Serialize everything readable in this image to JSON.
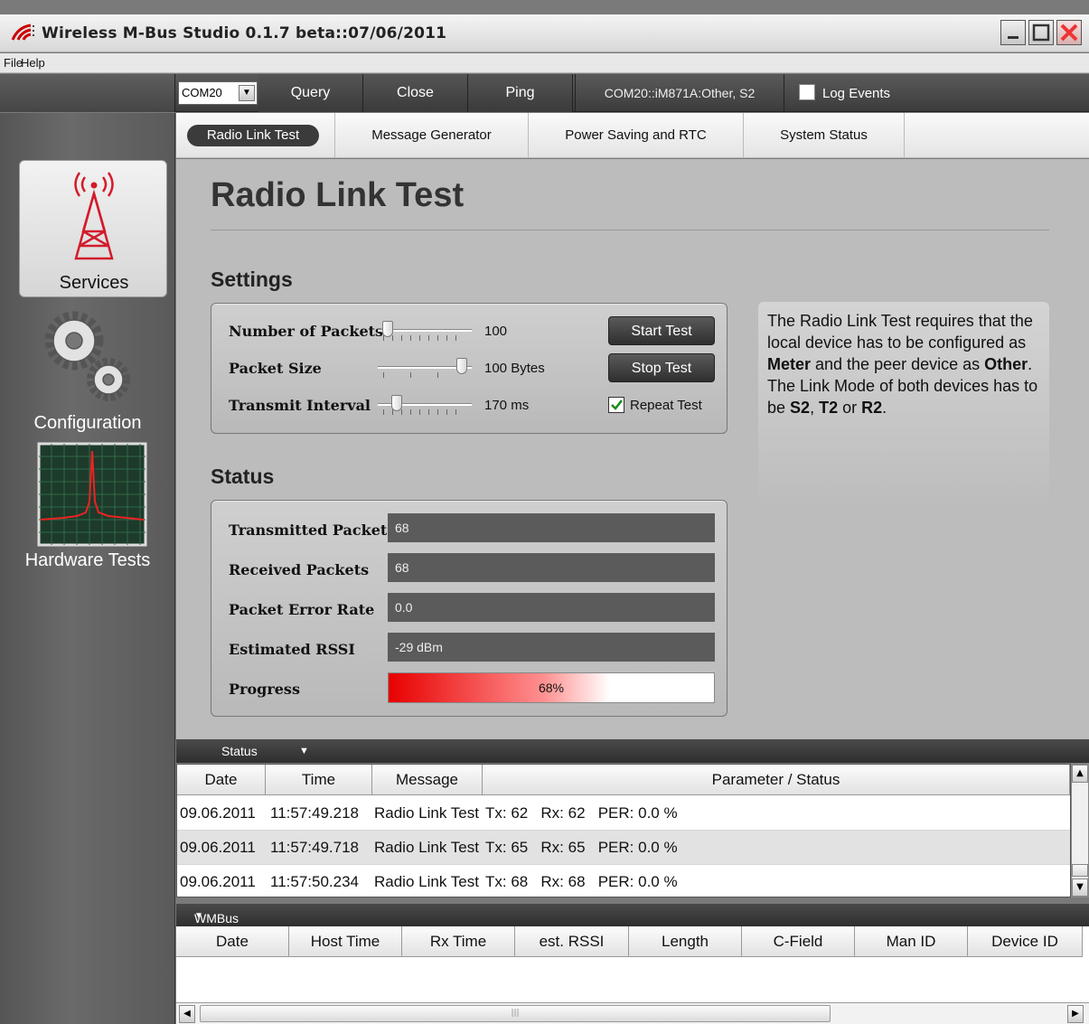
{
  "window": {
    "title": "Wireless M-Bus Studio  0.1.7 beta::07/06/2011"
  },
  "menu": {
    "file": "File",
    "help": "Help"
  },
  "toolbar": {
    "port_value": "COM20",
    "query_label": "Query",
    "close_label": "Close",
    "ping_label": "Ping",
    "connection_info": "COM20::iM871A:Other, S2",
    "log_events_label": "Log Events",
    "log_events_checked": false
  },
  "sidebar": {
    "items": [
      {
        "label": "Services",
        "icon": "radio-tower-icon",
        "active": true
      },
      {
        "label": "Configuration",
        "icon": "gears-icon",
        "active": false
      },
      {
        "label": "Hardware Tests",
        "icon": "spectrum-analyzer-icon",
        "active": false
      }
    ]
  },
  "tabs": [
    {
      "label": "Radio Link Test",
      "active": true
    },
    {
      "label": "Message Generator",
      "active": false
    },
    {
      "label": "Power Saving and RTC",
      "active": false
    },
    {
      "label": "System Status",
      "active": false
    }
  ],
  "page": {
    "title": "Radio Link Test",
    "settings_heading": "Settings",
    "status_heading": "Status"
  },
  "settings": {
    "num_packets": {
      "label": "Number of Packets",
      "value": "100",
      "slider_fraction": 0.05
    },
    "packet_size": {
      "label": "Packet Size",
      "value": "100 Bytes",
      "slider_fraction": 0.95
    },
    "transmit_interval": {
      "label": "Transmit Interval",
      "value": "170 ms",
      "slider_fraction": 0.16
    },
    "start_label": "Start Test",
    "stop_label": "Stop Test",
    "repeat_label": "Repeat Test",
    "repeat_checked": true
  },
  "info": {
    "t1": "The Radio Link Test requires that the local device has to be configured as ",
    "b1": "Meter",
    "t2": " and the peer device as ",
    "b2": "Other",
    "t3": ". The Link Mode of both devices has to be ",
    "b3": "S2",
    "t4": ", ",
    "b4": "T2",
    "t5": " or ",
    "b5": "R2",
    "t6": "."
  },
  "status": {
    "transmitted_label": "Transmitted Packets",
    "transmitted_value": "68",
    "received_label": "Received Packets",
    "received_value": "68",
    "per_label": "Packet Error Rate",
    "per_value": "0.0",
    "rssi_label": "Estimated RSSI",
    "rssi_value": "-29 dBm",
    "progress_label": "Progress",
    "progress_text": "68%",
    "progress_fraction": 0.68
  },
  "log": {
    "strip_label": "Status",
    "columns": [
      "Date",
      "Time",
      "Message",
      "Parameter / Status"
    ],
    "rows": [
      {
        "date": "09.06.2011",
        "time": "11:57:49.218",
        "message": "Radio Link Test",
        "param": "Tx: 62   Rx: 62   PER: 0.0 %"
      },
      {
        "date": "09.06.2011",
        "time": "11:57:49.718",
        "message": "Radio Link Test",
        "param": "Tx: 65   Rx: 65   PER: 0.0 %"
      },
      {
        "date": "09.06.2011",
        "time": "11:57:50.234",
        "message": "Radio Link Test",
        "param": "Tx: 68   Rx: 68   PER: 0.0 %"
      }
    ]
  },
  "wmbus": {
    "strip_label": "WMBus Messages",
    "columns": [
      "Date",
      "Host Time",
      "Rx Time",
      "est. RSSI",
      "Length",
      "C-Field",
      "Man ID",
      "Device ID"
    ]
  }
}
